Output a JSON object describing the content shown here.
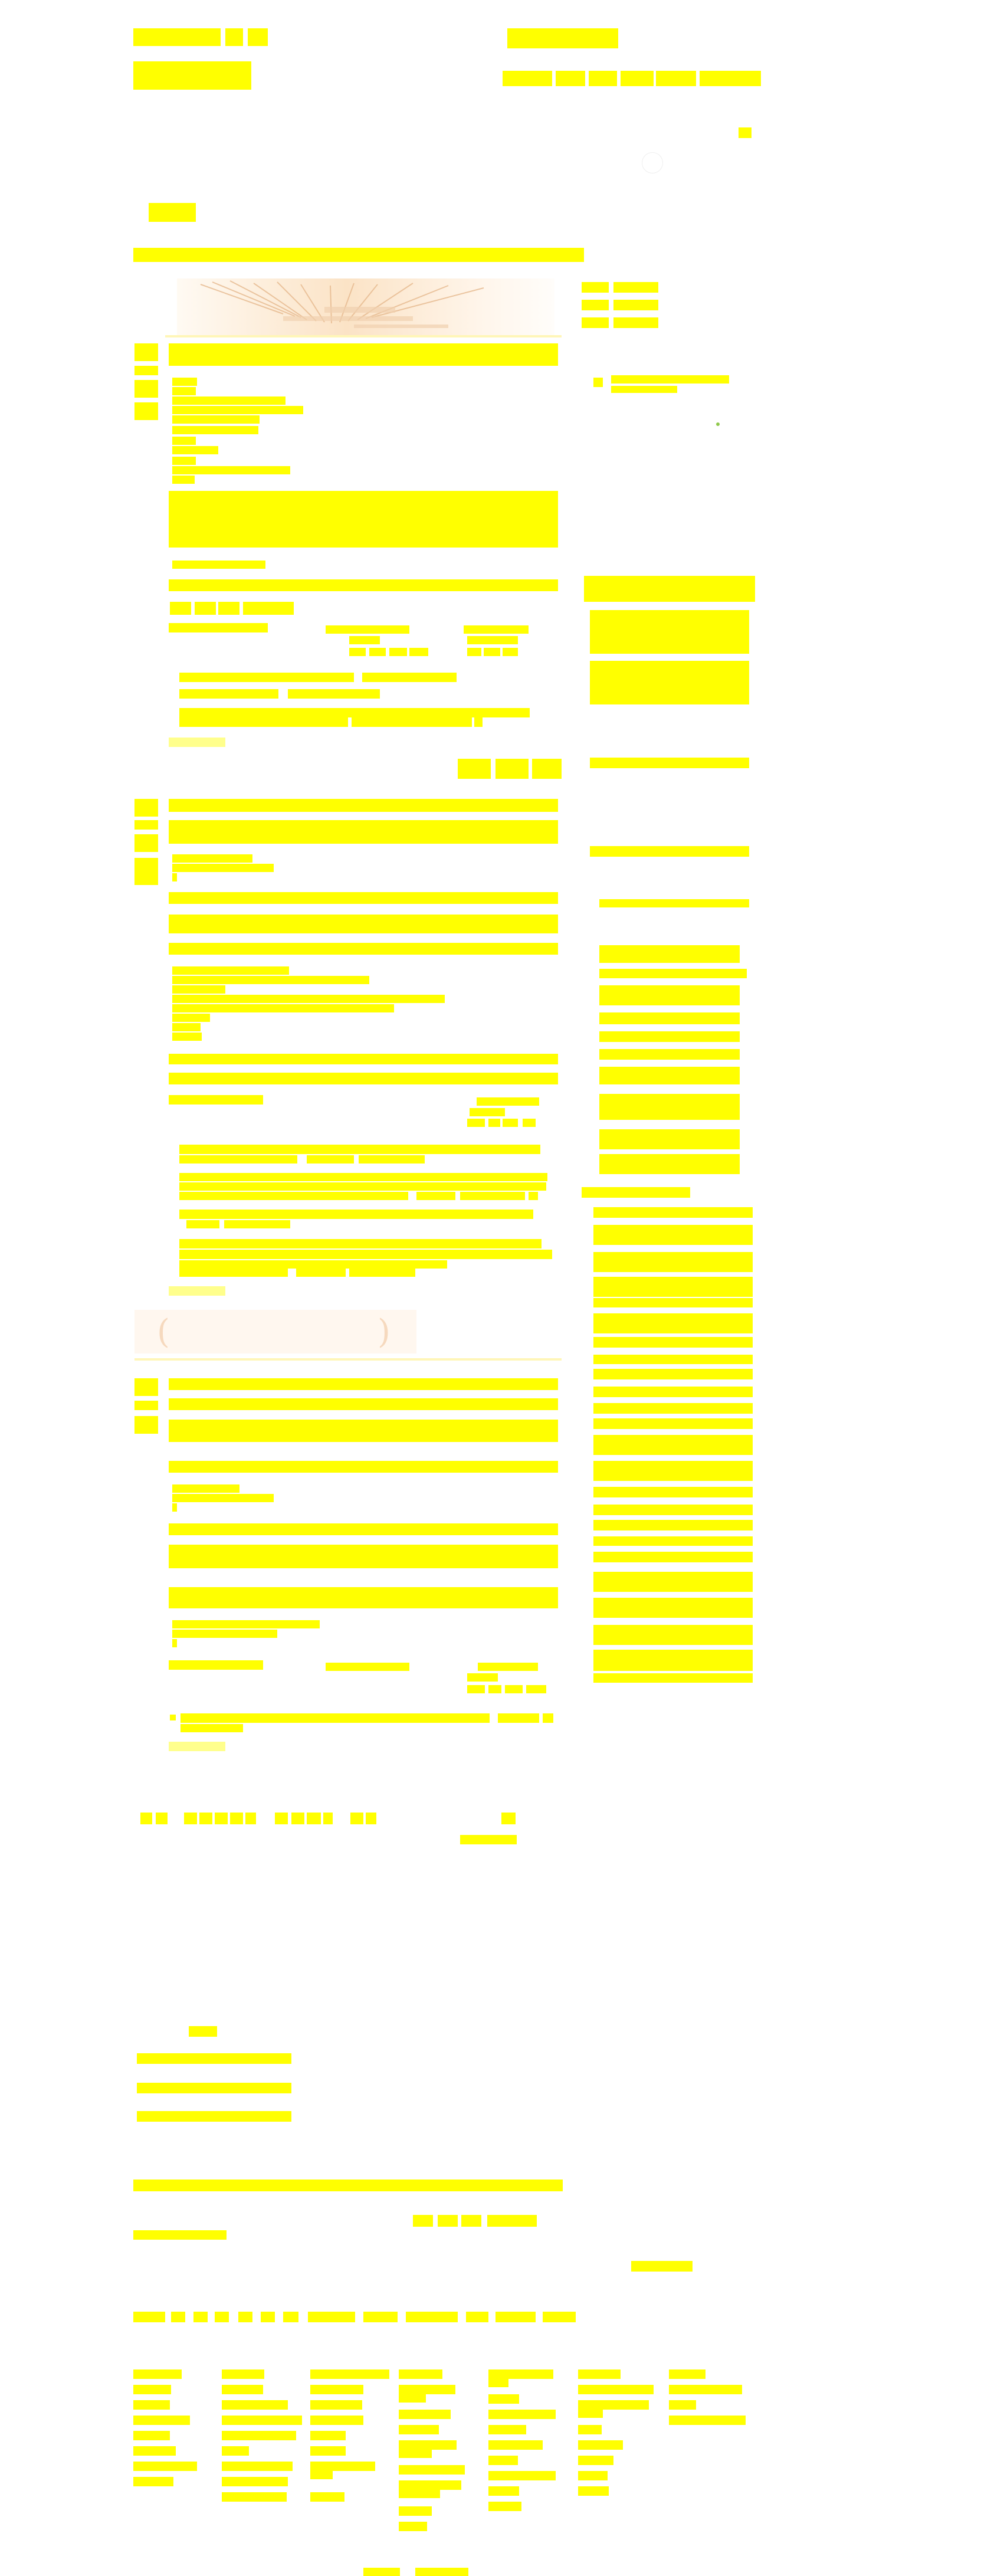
{
  "colors": {
    "highlight": "#ffff00",
    "banner_warm": "#fbe3c6",
    "quote_bg": "#fff7ef",
    "status_green": "#8fc84a"
  },
  "icons": [
    "search-icon",
    "close-icon",
    "quote-open-icon",
    "quote-close-icon"
  ]
}
